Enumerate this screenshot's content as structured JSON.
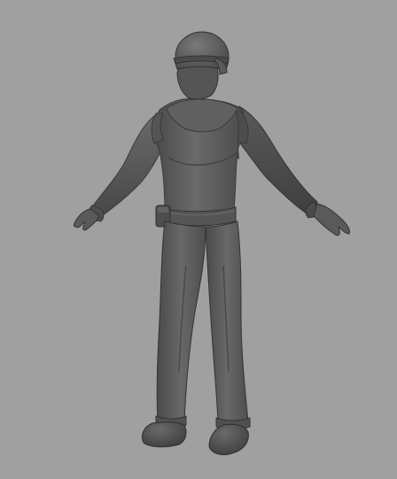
{
  "viewport": {
    "background": "#a0a0a0",
    "model_base_color": "#5c5c5c",
    "model_shadow_color": "#3a3a3a",
    "model_highlight_color": "#7a7a7a"
  },
  "model": {
    "subject": "t-pose-character",
    "parts": [
      "helmet",
      "face",
      "torso",
      "arms",
      "hands",
      "belt",
      "pouch",
      "legs",
      "boots"
    ]
  }
}
